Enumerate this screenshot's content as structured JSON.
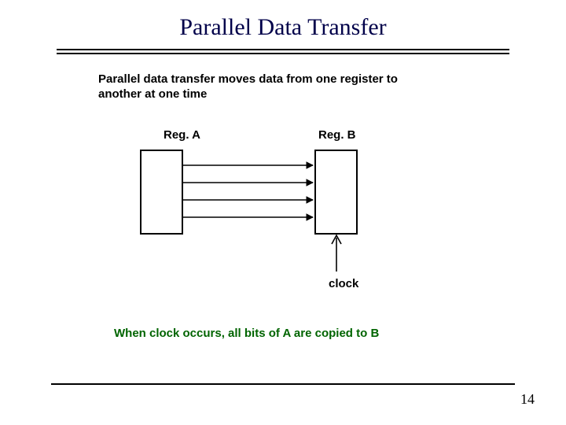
{
  "title": "Parallel Data Transfer",
  "description": "Parallel data transfer moves data from one register to another at one time",
  "labels": {
    "regA": "Reg. A",
    "regB": "Reg. B",
    "clock": "clock"
  },
  "note": "When clock occurs, all bits of A are copied to B",
  "pagenum": "14"
}
